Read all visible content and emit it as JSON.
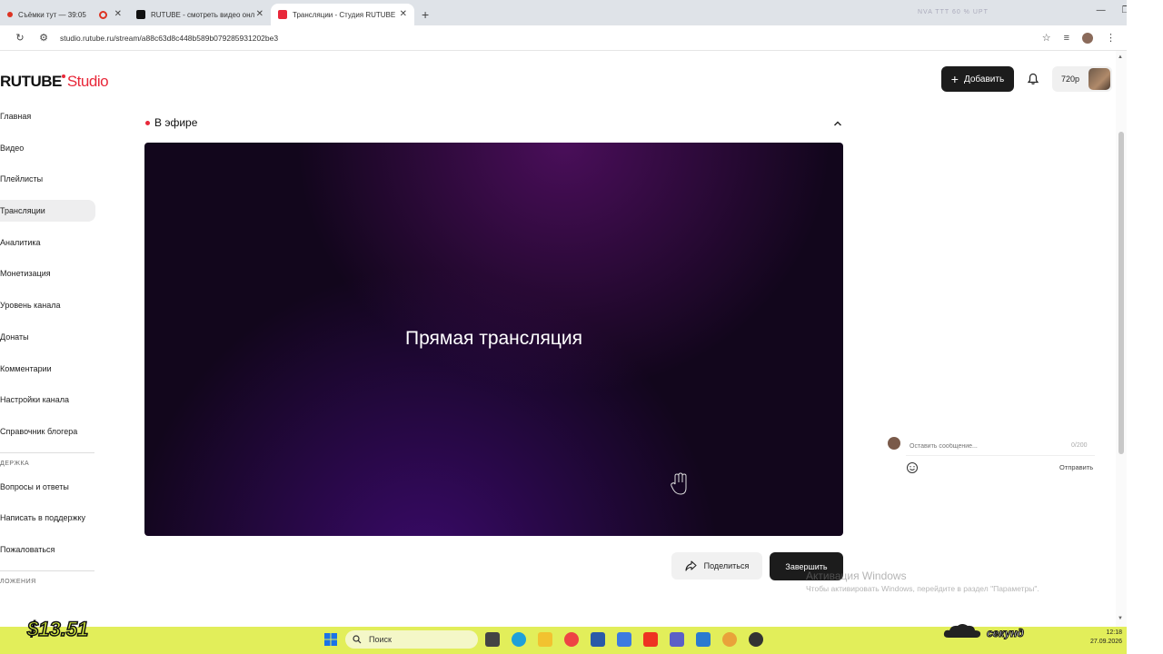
{
  "browser": {
    "tabs": [
      {
        "title": "Съёмки тут — 39:05"
      },
      {
        "title": "RUTUBE - смотреть видео онл"
      },
      {
        "title": "Трансляции - Студия RUTUBE"
      }
    ],
    "url": "studio.rutube.ru/stream/a88c63d8c448b589b079285931202be3",
    "tray_faint": "NVA   TTT 60 %   UPT"
  },
  "header": {
    "logo_main": "RUTUBE",
    "logo_studio": "Studio",
    "add_label": "Добавить",
    "resolution": "720p"
  },
  "sidebar": {
    "items": [
      {
        "label": "Главная"
      },
      {
        "label": "Видео"
      },
      {
        "label": "Плейлисты"
      },
      {
        "label": "Трансляции"
      },
      {
        "label": "Аналитика"
      },
      {
        "label": "Монетизация"
      },
      {
        "label": "Уровень канала"
      },
      {
        "label": "Донаты"
      },
      {
        "label": "Комментарии"
      },
      {
        "label": "Настройки канала"
      },
      {
        "label": "Справочник блогера"
      }
    ],
    "support_heading": "ДЕРЖКА",
    "support_items": [
      {
        "label": "Вопросы и ответы"
      },
      {
        "label": "Написать в поддержку"
      },
      {
        "label": "Пожаловаться"
      }
    ],
    "bottom_heading": "ЛОЖЕНИЯ"
  },
  "stream": {
    "status": "В эфире",
    "player_title": "Прямая трансляция",
    "share_label": "Поделиться",
    "end_label": "Завершить"
  },
  "chat": {
    "placeholder": "Оставить сообщение...",
    "counter": "0/200",
    "send_label": "Отправить"
  },
  "watermark": {
    "title": "Активация Windows",
    "subtitle": "Чтобы активировать Windows, перейдите в раздел \"Параметры\"."
  },
  "taskbar": {
    "search_label": "Поиск",
    "overlay_money": "$13.51",
    "overlay_seconds": "секунд",
    "clock_time": "12:18",
    "clock_date": "27.09.2026"
  },
  "colors": {
    "brand_red": "#e8283a",
    "dark_button": "#1c1c1c",
    "taskbar": "#e2ee5a"
  }
}
